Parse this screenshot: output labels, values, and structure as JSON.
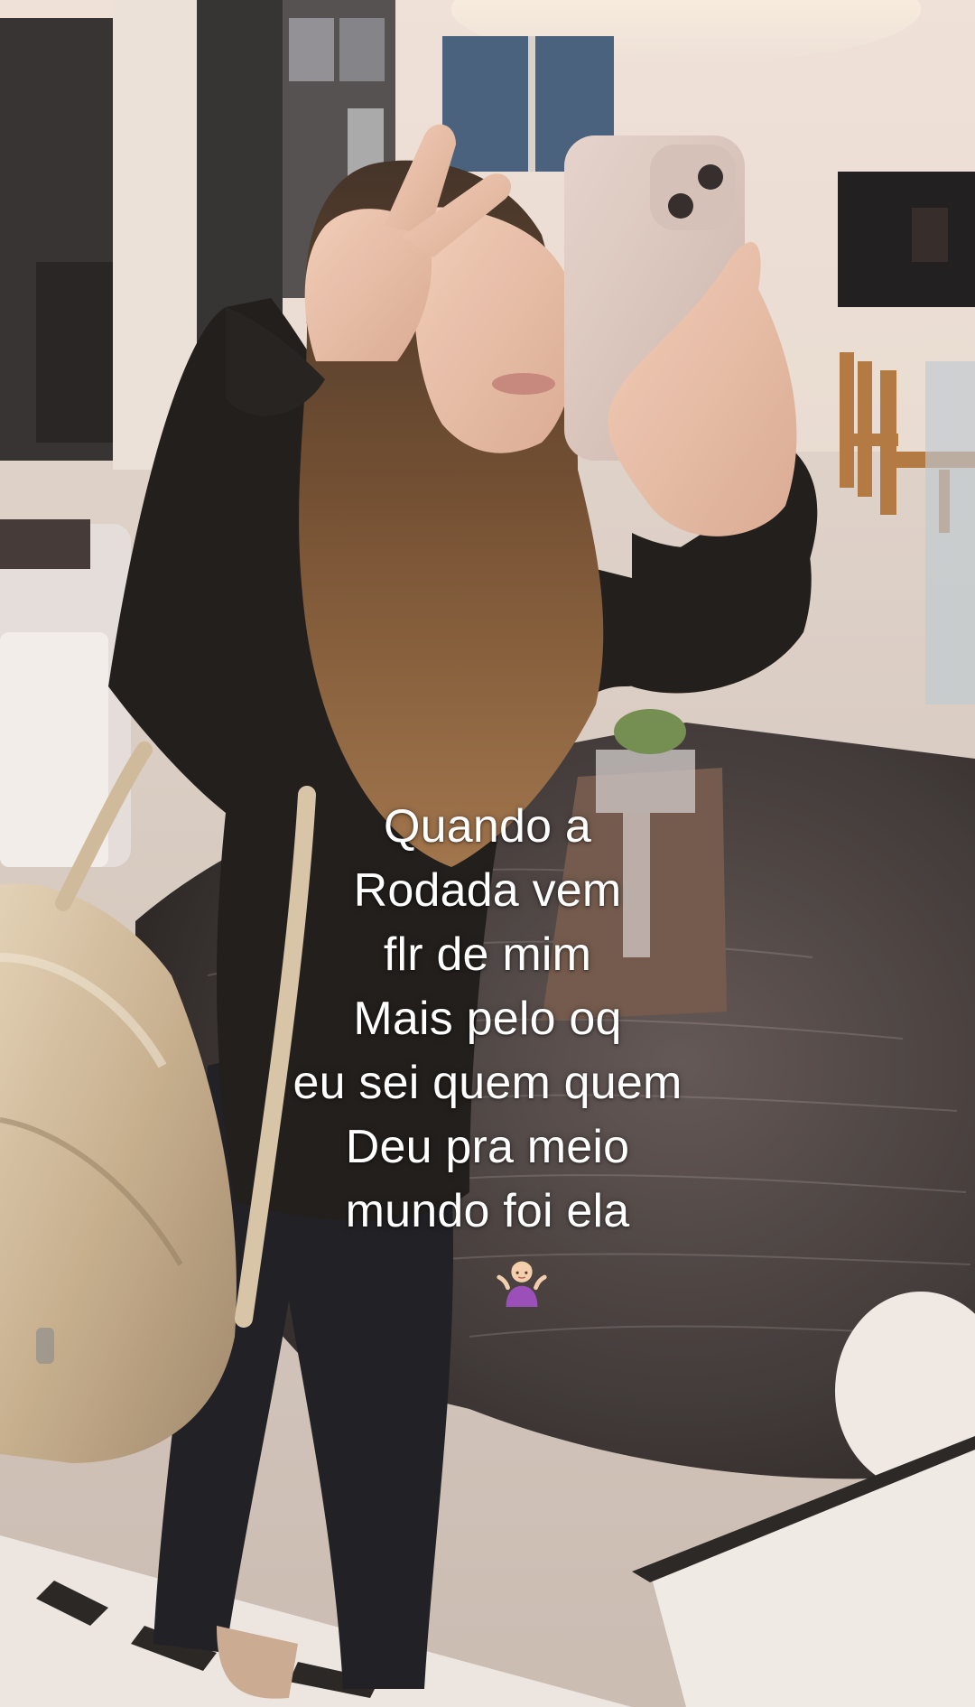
{
  "caption": {
    "lines": [
      "Quando a",
      "Rodada vem",
      "flr de mim",
      "Mais pelo oq",
      "eu sei quem quem",
      "Deu pra meio",
      "mundo foi ela"
    ],
    "emoji": "🤷🏼‍♀️",
    "emoji_name": "person-shrugging-emoji"
  },
  "colors": {
    "caption_text": "#ffffff",
    "rug": "#3a3434",
    "wall": "#e8dcd3",
    "hoodie": "#161414",
    "phone_case": "#d9c7bf",
    "backpack": "#c9b496"
  }
}
